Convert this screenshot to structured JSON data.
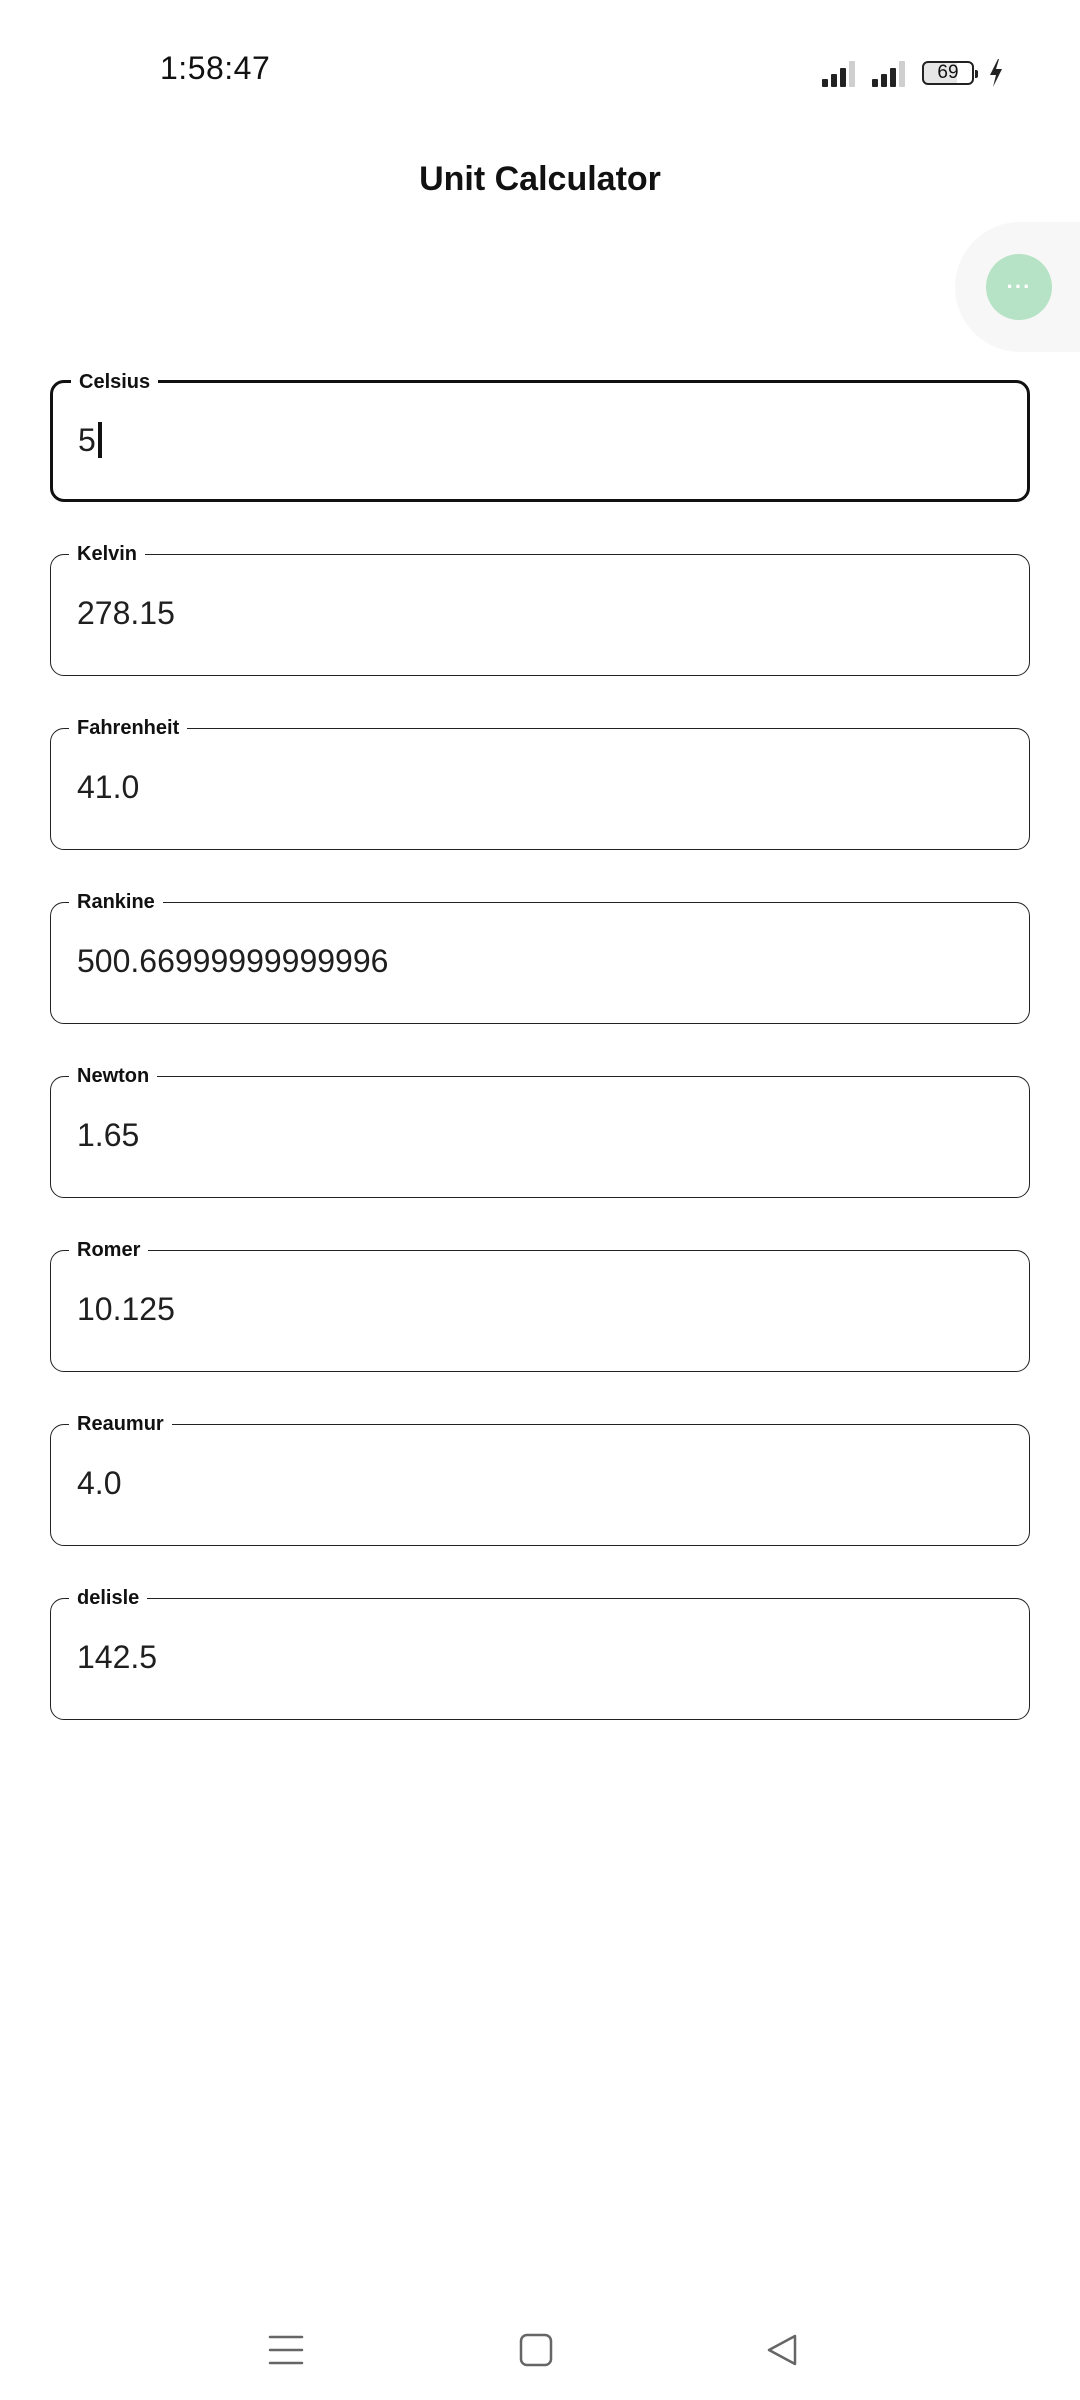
{
  "status_bar": {
    "time": "1:58:47",
    "battery": "69",
    "icons": [
      "signal-icon",
      "signal-icon",
      "battery-icon",
      "charging-bolt-icon"
    ]
  },
  "header": {
    "title": "Unit Calculator"
  },
  "fab": {
    "icon": "more-dots-icon",
    "glyph": "···",
    "color": "#b6e3c5"
  },
  "fields": [
    {
      "label": "Celsius",
      "value": "5"
    },
    {
      "label": "Kelvin",
      "value": "278.15"
    },
    {
      "label": "Fahrenheit",
      "value": "41.0"
    },
    {
      "label": "Rankine",
      "value": "500.66999999999996"
    },
    {
      "label": "Newton",
      "value": "1.65"
    },
    {
      "label": "Romer",
      "value": "10.125"
    },
    {
      "label": "Reaumur",
      "value": "4.0"
    },
    {
      "label": "delisle",
      "value": "142.5"
    }
  ],
  "nav_bar": {
    "icons": [
      "menu-icon",
      "home-icon",
      "back-icon"
    ]
  }
}
